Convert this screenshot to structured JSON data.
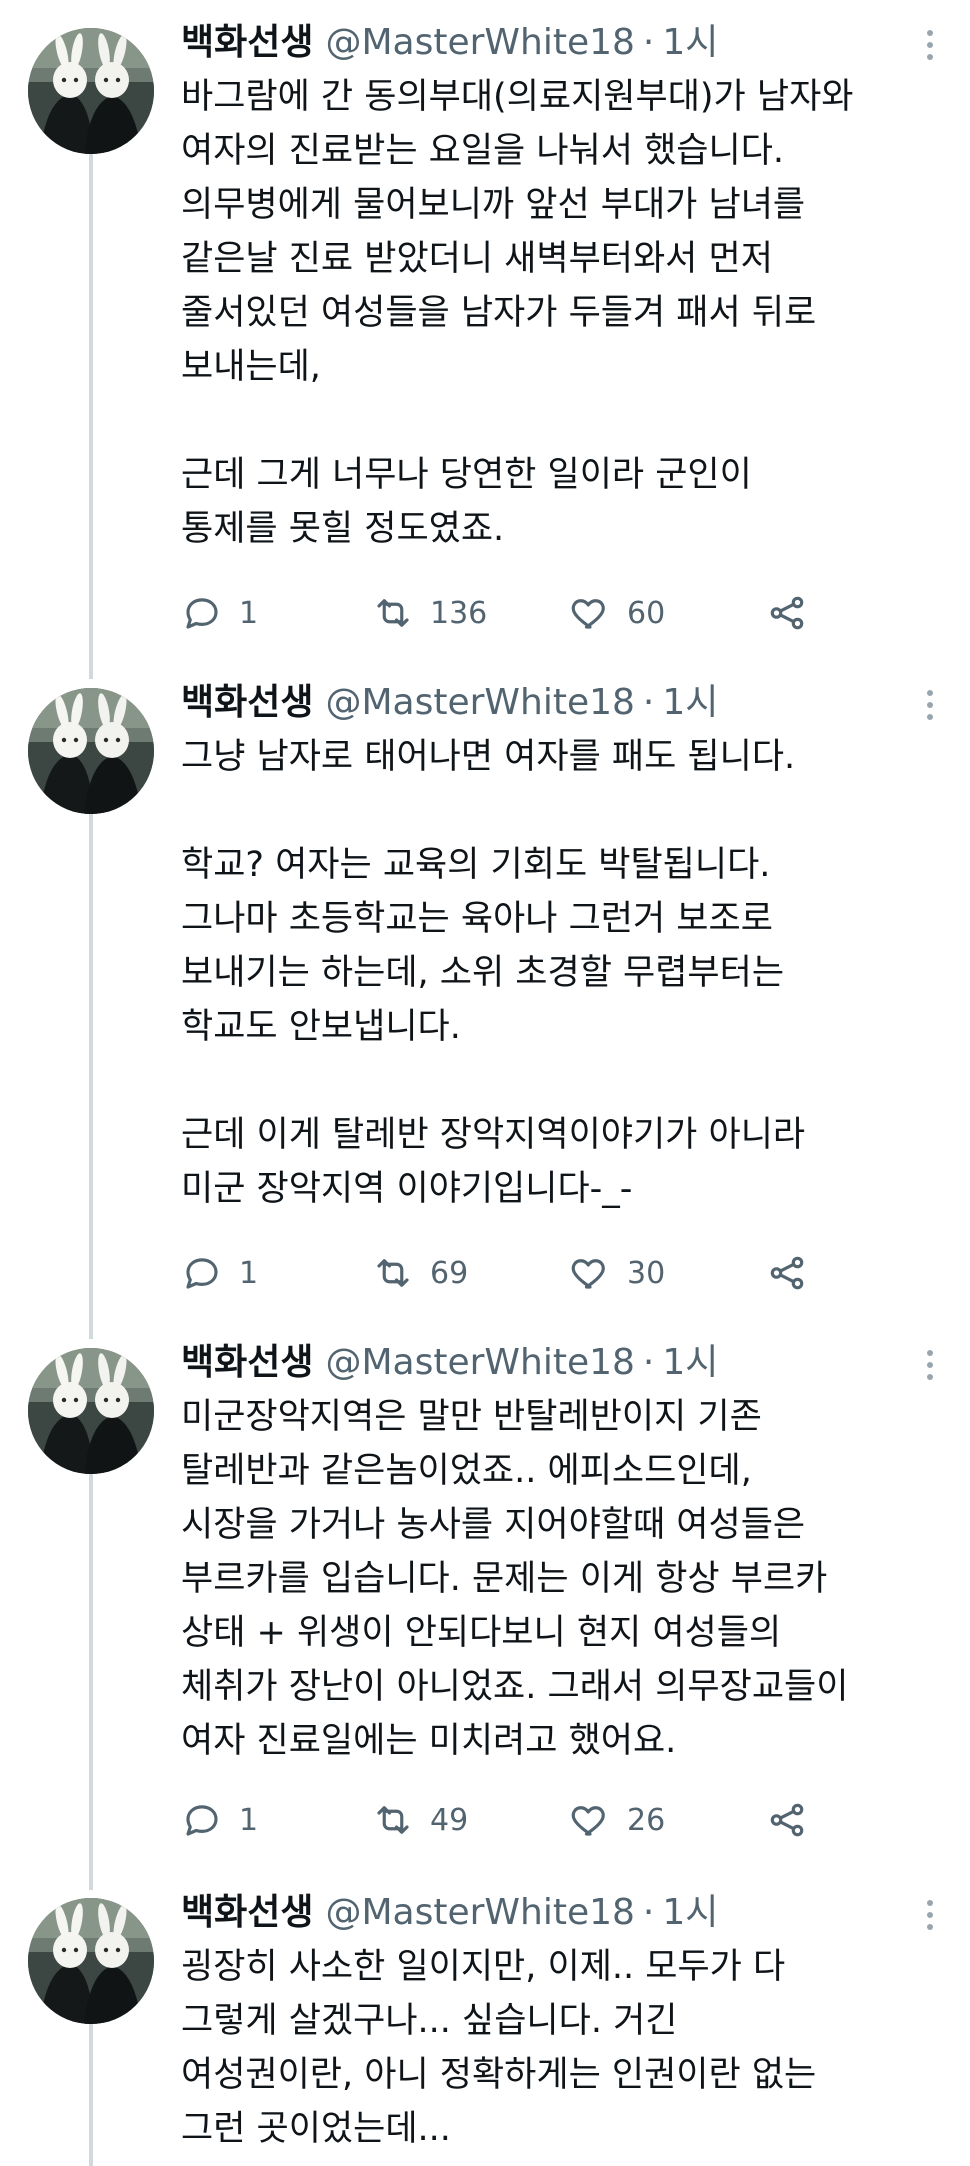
{
  "tweets": [
    {
      "author": {
        "name": "백화선생",
        "handle": "@MasterWhite18",
        "time": "1시"
      },
      "lines": [
        "바그람에 간 동의부대(의료지원부대)가 남자와",
        "여자의 진료받는 요일을 나눠서 했습니다.",
        "의무병에게 물어보니까 앞선 부대가 남녀를",
        "같은날 진료 받았더니 새벽부터와서 먼저",
        "줄서있던 여성들을 남자가 두들겨 패서 뒤로",
        "보내는데,",
        "",
        "근데 그게 너무나 당연한 일이라 군인이",
        "통제를 못힐 정도였죠."
      ],
      "stats": {
        "replies": "1",
        "retweets": "136",
        "likes": "60"
      }
    },
    {
      "author": {
        "name": "백화선생",
        "handle": "@MasterWhite18",
        "time": "1시"
      },
      "lines": [
        "그냥 남자로 태어나면 여자를 패도 됩니다.",
        "",
        "학교? 여자는 교육의 기회도 박탈됩니다.",
        "그나마 초등학교는 육아나 그런거 보조로",
        "보내기는 하는데, 소위 초경할 무렵부터는",
        "학교도 안보냅니다.",
        "",
        "근데 이게 탈레반 장악지역이야기가 아니라",
        "미군 장악지역 이야기입니다-_-"
      ],
      "stats": {
        "replies": "1",
        "retweets": "69",
        "likes": "30"
      }
    },
    {
      "author": {
        "name": "백화선생",
        "handle": "@MasterWhite18",
        "time": "1시"
      },
      "lines": [
        "미군장악지역은 말만 반탈레반이지 기존",
        "탈레반과 같은놈이었죠.. 에피소드인데,",
        "시장을 가거나 농사를 지어야할때 여성들은",
        "부르카를 입습니다. 문제는 이게 항상 부르카",
        "상태 + 위생이 안되다보니 현지 여성들의",
        "체취가 장난이 아니었죠. 그래서 의무장교들이",
        "여자 진료일에는 미치려고 했어요."
      ],
      "stats": {
        "replies": "1",
        "retweets": "49",
        "likes": "26"
      }
    },
    {
      "author": {
        "name": "백화선생",
        "handle": "@MasterWhite18",
        "time": "1시"
      },
      "lines": [
        "굉장히 사소한 일이지만, 이제.. 모두가 다",
        "그렇게 살겠구나... 싶습니다. 거긴",
        "여성권이란, 아니 정확하게는 인권이란 없는",
        "그런 곳이었는데..."
      ],
      "stats": null
    }
  ],
  "colors": {
    "text_primary": "#0f1419",
    "text_secondary": "#536471",
    "thread_line": "#cfd9de"
  },
  "icons": {
    "reply": "speech-bubble-icon",
    "retweet": "retweet-arrows-icon",
    "like": "heart-outline-icon",
    "share": "share-icon",
    "more": "three-dot-vertical-icon"
  }
}
